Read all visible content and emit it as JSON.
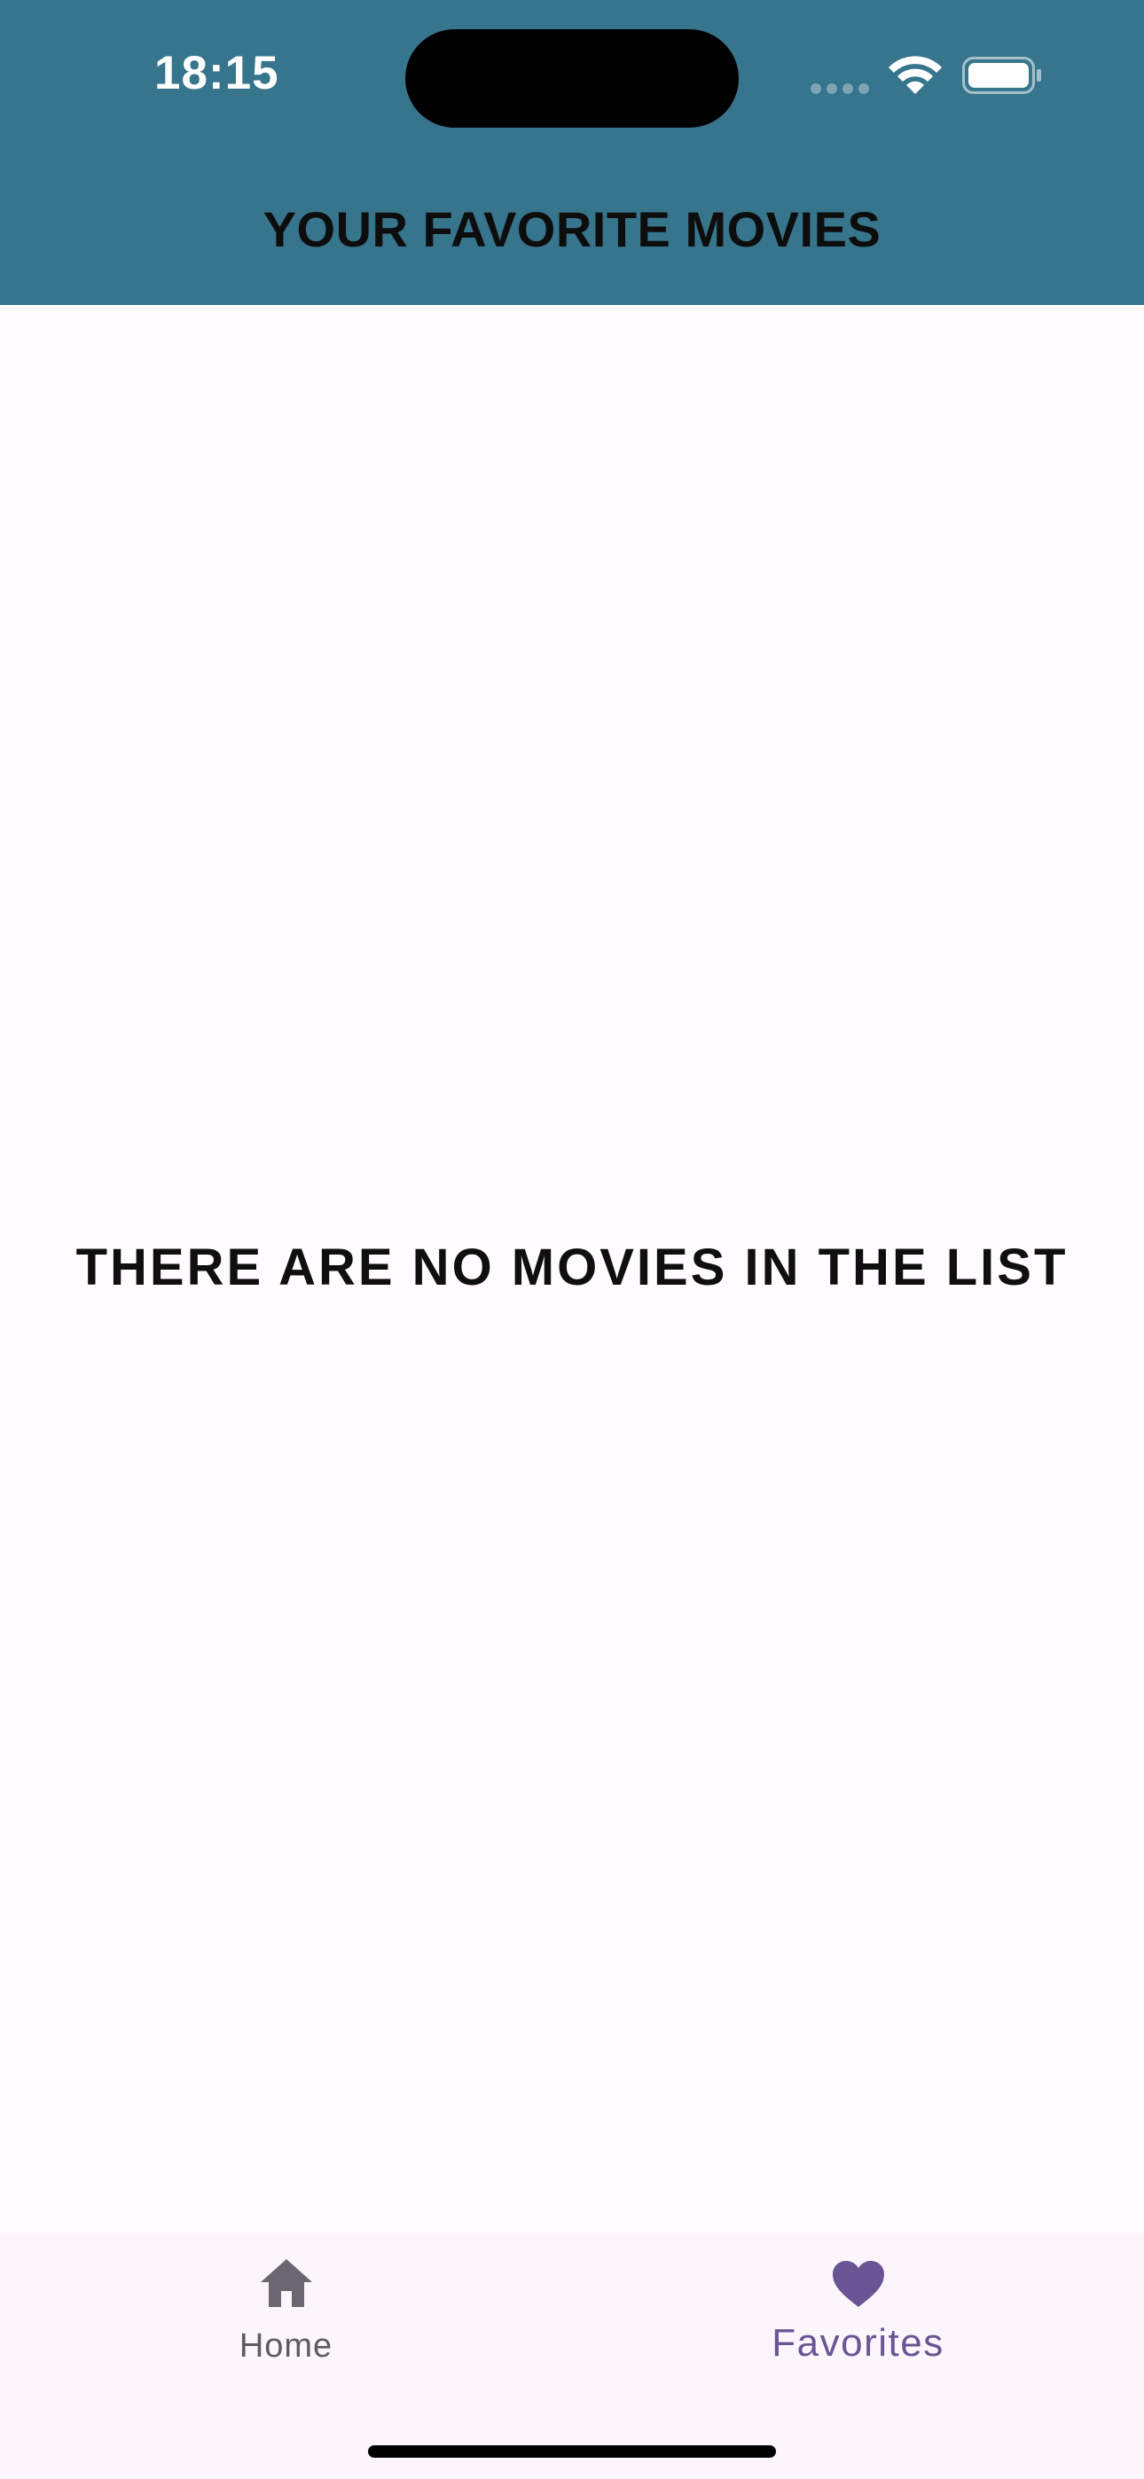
{
  "status_bar": {
    "time": "18:15",
    "icons": [
      "cellular-signal-icon",
      "wifi-icon",
      "battery-icon"
    ]
  },
  "header": {
    "title": "YOUR FAVORITE MOVIES"
  },
  "main": {
    "empty_message": "THERE ARE NO MOVIES IN THE LIST"
  },
  "bottom_nav": {
    "items": [
      {
        "label": "Home",
        "icon": "home-icon",
        "selected": false
      },
      {
        "label": "Favorites",
        "icon": "heart-icon",
        "selected": true
      }
    ]
  },
  "colors": {
    "header_background": "#37758d",
    "page_background": "#fffbfe",
    "nav_background": "#fcf6fc",
    "nav_selected": "#6a5494",
    "nav_unselected": "#5e5a62"
  }
}
